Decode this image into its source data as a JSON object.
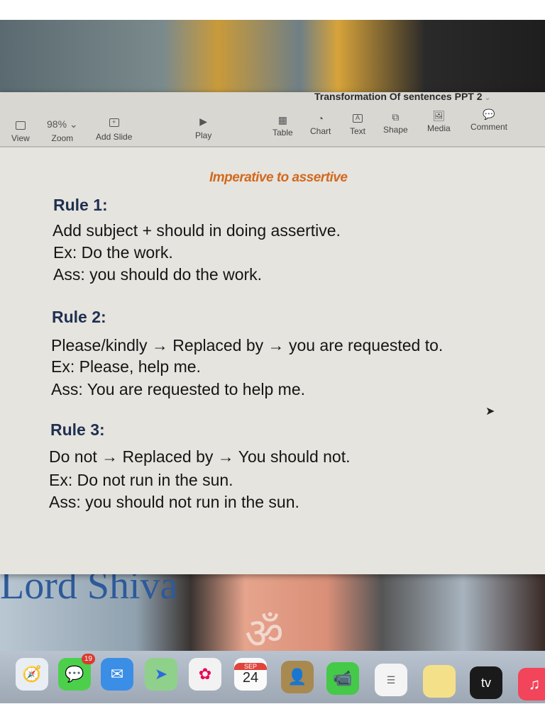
{
  "window": {
    "title": "Transformation Of sentences PPT 2"
  },
  "toolbar": {
    "view": "View",
    "zoom_value": "98%",
    "zoom": "Zoom",
    "add_slide": "Add Slide",
    "play": "Play",
    "table": "Table",
    "chart": "Chart",
    "text": "Text",
    "shape": "Shape",
    "media": "Media",
    "comment": "Comment"
  },
  "slide": {
    "heading": "Imperative to assertive",
    "rules": [
      {
        "title": "Rule 1:",
        "lines": [
          "Add subject + should in doing assertive.",
          "Ex: Do the work.",
          "Ass: you should do the work."
        ]
      },
      {
        "title": "Rule 2:",
        "lines": [
          "Please/kindly → Replaced by → you are requested to.",
          "Ex: Please, help me.",
          "Ass: You are requested to help me."
        ]
      },
      {
        "title": "Rule 3:",
        "lines": [
          "Do not → Replaced by → You should not.",
          "Ex: Do not run in the sun.",
          "Ass: you should not run in the sun."
        ]
      }
    ]
  },
  "wallpaper": {
    "text": "Lord Shiva"
  },
  "dock": {
    "messages_badge": "19",
    "calendar_month": "SEP",
    "calendar_day": "24",
    "tv_label": "tv"
  }
}
